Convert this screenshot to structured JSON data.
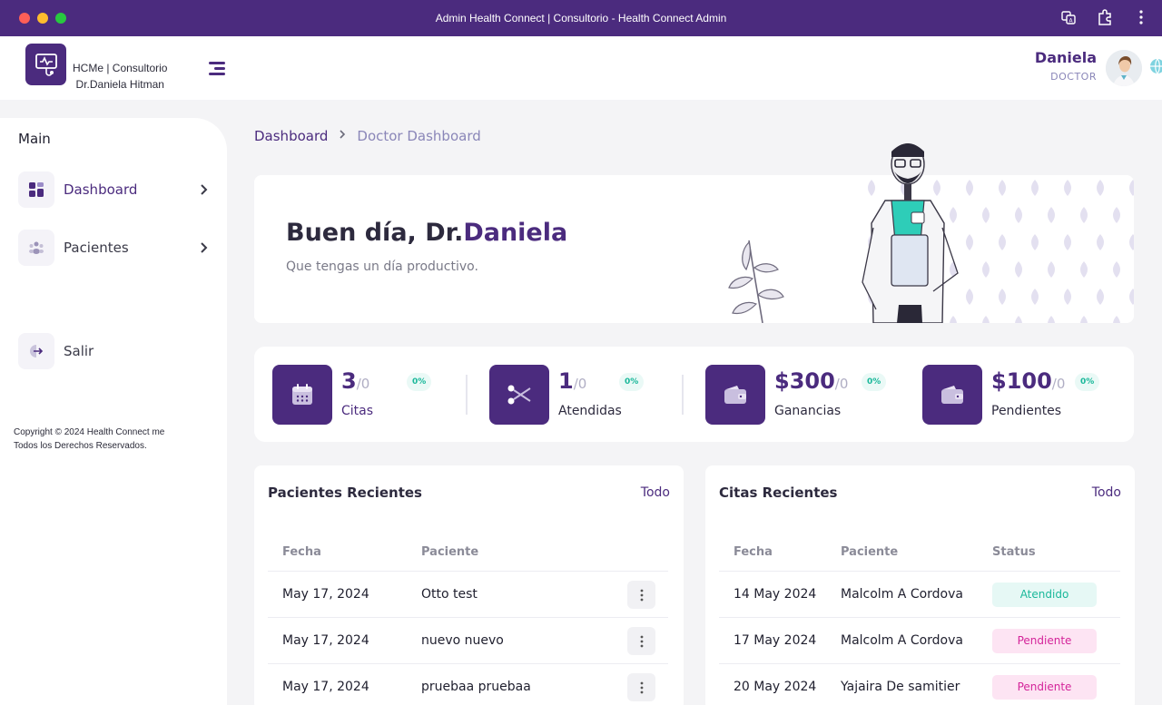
{
  "window": {
    "title": "Admin Health Connect | Consultorio - Health Connect Admin"
  },
  "header": {
    "brand_line1": "HCMe | Consultorio",
    "brand_line2": "Dr.Daniela Hitman",
    "user_name": "Daniela",
    "user_role": "DOCTOR"
  },
  "sidebar": {
    "section": "Main",
    "items": [
      {
        "label": "Dashboard",
        "icon": "dashboard-icon"
      },
      {
        "label": "Pacientes",
        "icon": "patients-icon"
      },
      {
        "label": "Salir",
        "icon": "logout-icon"
      }
    ],
    "copyright_line1": "Copyright © 2024 Health Connect me",
    "copyright_line2": "Todos los Derechos Reservados."
  },
  "breadcrumb": {
    "root": "Dashboard",
    "current": "Doctor Dashboard"
  },
  "welcome": {
    "greeting": "Buen día, Dr.",
    "name": "Daniela",
    "subtitle": "Que tengas un día productivo."
  },
  "stats": [
    {
      "value": "3",
      "total": "/0",
      "pct": "0%",
      "label": "Citas",
      "icon": "calendar-icon"
    },
    {
      "value": "1",
      "total": "/0",
      "pct": "0%",
      "label": "Atendidas",
      "icon": "scissors-icon"
    },
    {
      "value": "$300",
      "total": "/0",
      "pct": "0%",
      "label": "Ganancias",
      "icon": "wallet-icon"
    },
    {
      "value": "$100",
      "total": "/0",
      "pct": "0%",
      "label": "Pendientes",
      "icon": "wallet-icon"
    }
  ],
  "recent_patients": {
    "title": "Pacientes Recientes",
    "link": "Todo",
    "columns": [
      "Fecha",
      "Paciente"
    ],
    "rows": [
      {
        "date": "May 17, 2024",
        "patient": "Otto test"
      },
      {
        "date": "May 17, 2024",
        "patient": "nuevo nuevo"
      },
      {
        "date": "May 17, 2024",
        "patient": "pruebaa pruebaa"
      }
    ]
  },
  "recent_appointments": {
    "title": "Citas Recientes",
    "link": "Todo",
    "columns": [
      "Fecha",
      "Paciente",
      "Status"
    ],
    "rows": [
      {
        "date": "14 May 2024",
        "patient": "Malcolm A Cordova",
        "status": "Atendido"
      },
      {
        "date": "17 May 2024",
        "patient": "Malcolm A Cordova",
        "status": "Pendiente"
      },
      {
        "date": "20 May 2024",
        "patient": "Yajaira De samitier",
        "status": "Pendiente"
      }
    ]
  },
  "colors": {
    "brand": "#4b2b7e",
    "accent_teal": "#1ab89a",
    "pending_pink": "#d4249a"
  }
}
